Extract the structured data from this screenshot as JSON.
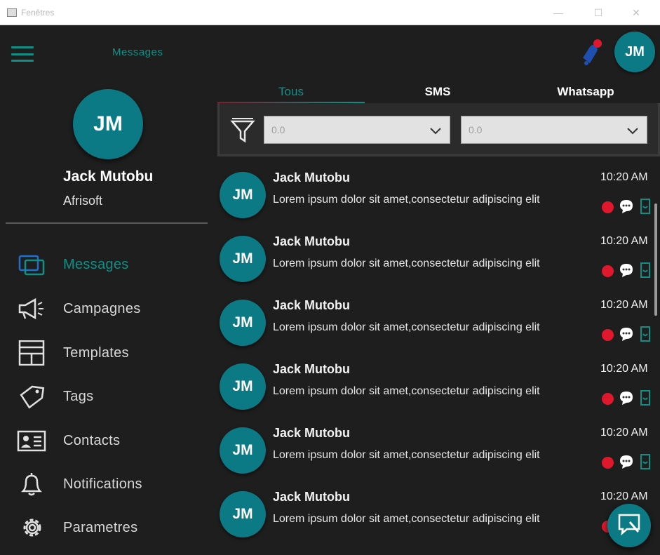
{
  "window": {
    "title": "Fenêtres",
    "minimize_glyph": "—",
    "maximize_glyph": "☐",
    "close_glyph": "✕"
  },
  "appbar": {
    "title": "Messages",
    "avatar_initials": "JM",
    "accent_color": "#0f8f86",
    "avatar_color": "#0b7a85"
  },
  "profile": {
    "initials": "JM",
    "name": "Jack Mutobu",
    "company": "Afrisoft"
  },
  "nav": {
    "items": [
      {
        "label": "Messages",
        "icon": "chat-icon",
        "active": true
      },
      {
        "label": "Campagnes",
        "icon": "megaphone-icon",
        "active": false
      },
      {
        "label": "Templates",
        "icon": "template-icon",
        "active": false
      },
      {
        "label": "Tags",
        "icon": "tag-icon",
        "active": false
      },
      {
        "label": "Contacts",
        "icon": "contact-card-icon",
        "active": false
      },
      {
        "label": "Notifications",
        "icon": "bell-icon",
        "active": false
      },
      {
        "label": "Parametres",
        "icon": "gear-icon",
        "active": false
      }
    ]
  },
  "tabs": [
    {
      "label": "Tous",
      "active": true
    },
    {
      "label": "SMS",
      "active": false
    },
    {
      "label": "Whatsapp",
      "active": false
    }
  ],
  "filters": {
    "dropdown1_value": "0.0",
    "dropdown2_value": "0.0"
  },
  "messages": [
    {
      "initials": "JM",
      "name": "Jack Mutobu",
      "time": "10:20 AM",
      "text": "Lorem ipsum dolor sit amet,consectetur adipiscing elit"
    },
    {
      "initials": "JM",
      "name": "Jack Mutobu",
      "time": "10:20 AM",
      "text": "Lorem ipsum dolor sit amet,consectetur adipiscing elit"
    },
    {
      "initials": "JM",
      "name": "Jack Mutobu",
      "time": "10:20 AM",
      "text": "Lorem ipsum dolor sit amet,consectetur adipiscing elit"
    },
    {
      "initials": "JM",
      "name": "Jack Mutobu",
      "time": "10:20 AM",
      "text": "Lorem ipsum dolor sit amet,consectetur adipiscing elit"
    },
    {
      "initials": "JM",
      "name": "Jack Mutobu",
      "time": "10:20 AM",
      "text": "Lorem ipsum dolor sit amet,consectetur adipiscing elit"
    },
    {
      "initials": "JM",
      "name": "Jack Mutobu",
      "time": "10:20 AM",
      "text": "Lorem ipsum dolor sit amet,consectetur adipiscing elit"
    }
  ]
}
